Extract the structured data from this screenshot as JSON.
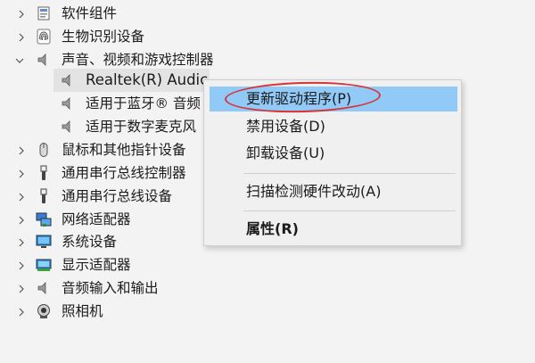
{
  "tree": {
    "items": [
      {
        "label": "软件组件",
        "state": "collapsed",
        "icon": "software-component-icon"
      },
      {
        "label": "生物识别设备",
        "state": "collapsed",
        "icon": "fingerprint-icon"
      },
      {
        "label": "声音、视频和游戏控制器",
        "state": "expanded",
        "icon": "speaker-icon"
      },
      {
        "label": "Realtek(R) Audic",
        "icon": "speaker-icon"
      },
      {
        "label": "适用于蓝牙® 音频",
        "icon": "speaker-icon"
      },
      {
        "label": "适用于数字麦克风",
        "icon": "speaker-icon"
      },
      {
        "label": "鼠标和其他指针设备",
        "state": "collapsed",
        "icon": "mouse-icon"
      },
      {
        "label": "通用串行总线控制器",
        "state": "collapsed",
        "icon": "usb-icon"
      },
      {
        "label": "通用串行总线设备",
        "state": "collapsed",
        "icon": "usb-icon"
      },
      {
        "label": "网络适配器",
        "state": "collapsed",
        "icon": "network-icon"
      },
      {
        "label": "系统设备",
        "state": "collapsed",
        "icon": "monitor-icon"
      },
      {
        "label": "显示适配器",
        "state": "collapsed",
        "icon": "display-adapter-icon"
      },
      {
        "label": "音频输入和输出",
        "state": "collapsed",
        "icon": "speaker-icon"
      },
      {
        "label": "照相机",
        "state": "collapsed",
        "icon": "camera-icon"
      }
    ]
  },
  "context_menu": {
    "items": [
      {
        "label": "更新驱动程序(P)",
        "highlighted": true
      },
      {
        "label": "禁用设备(D)"
      },
      {
        "label": "卸载设备(U)"
      },
      {
        "label": "扫描检测硬件改动(A)"
      },
      {
        "label": "属性(R)",
        "bold": true
      }
    ]
  },
  "colors": {
    "highlight": "#91c9f7",
    "annotation": "#d7343a",
    "background": "#f3f3f3"
  }
}
